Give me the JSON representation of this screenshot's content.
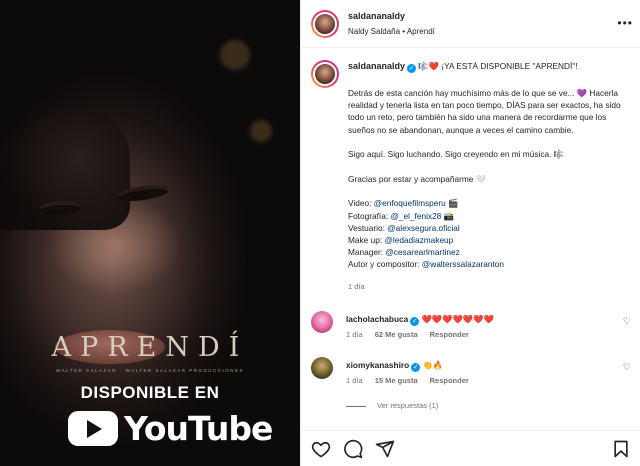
{
  "media": {
    "title": "APRENDÍ",
    "credit": "WALTER SALAZAR · WALTER SALAZAR PRODUCCIONES",
    "available": "DISPONIBLE EN",
    "platform": "YouTube"
  },
  "header": {
    "username": "saldananaldy",
    "subtitle": "Naldy Saldaña • Aprendí",
    "more_icon": "more-horizontal-icon"
  },
  "caption": {
    "username": "saldananaldy",
    "lead_emoji": "🎼❤️",
    "headline": "¡YA ESTÁ DISPONIBLE \"APRENDÍ\"!",
    "para1": "Detrás de esta canción hay muchísimo más de lo que se ve... 💜 Hacerla realidad y tenerla lista en tan poco tiempo, DÍAS para ser exactos, ha sido todo un reto, pero también ha sido una manera de recordarme que los sueños no se abandonan, aunque a veces el camino cambie.",
    "para2": "Sigo aquí. Sigo luchando. Sigo creyendo en mi música. 🎼",
    "para3": "Gracias por estar y acompañarme 🤍",
    "credits": [
      {
        "label": "Video: ",
        "handle": "@enfoquefilmsperu",
        "emoji": " 🎬"
      },
      {
        "label": "Fotografía: ",
        "handle": "@_el_fenix28",
        "emoji": " 📸"
      },
      {
        "label": "Vestuario: ",
        "handle": "@alexsegura.oficial",
        "emoji": ""
      },
      {
        "label": "Make up: ",
        "handle": "@ledadiazmakeup",
        "emoji": ""
      },
      {
        "label": "Manager: ",
        "handle": "@cesarearlmartinez",
        "emoji": ""
      },
      {
        "label": "Autor y compositor: ",
        "handle": "@walterssalazaranton",
        "emoji": ""
      }
    ],
    "time": "1 día"
  },
  "comments": [
    {
      "username": "lacholachabuca",
      "text": "❤️❤️❤️❤️❤️❤️❤️",
      "time": "1 día",
      "likes": "62 Me gusta",
      "reply": "Responder"
    },
    {
      "username": "xiomykanashiro",
      "text": "👏🔥",
      "time": "1 día",
      "likes": "15 Me gusta",
      "reply": "Responder"
    }
  ],
  "view_replies": "Ver respuestas (1)",
  "colors": {
    "link": "#00376b",
    "verified": "#0095f6",
    "muted": "#737373"
  }
}
